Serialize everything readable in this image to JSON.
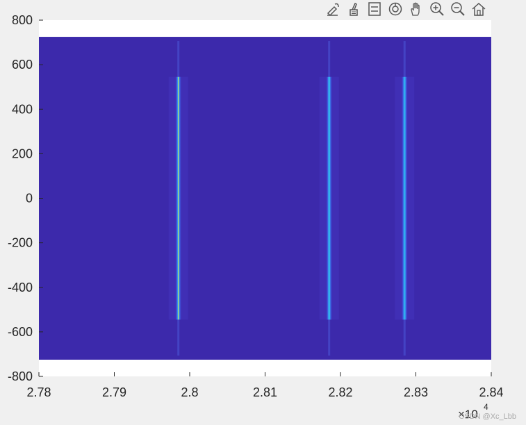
{
  "toolbar": {
    "icons": [
      "brush-edit-icon",
      "data-cursor-icon",
      "legend-icon",
      "rotate-icon",
      "pan-hand-icon",
      "zoom-in-icon",
      "zoom-out-icon",
      "home-icon"
    ]
  },
  "chart_data": {
    "type": "heatmap",
    "title": "",
    "xlabel": "",
    "ylabel": "",
    "xlim": [
      27800,
      28400
    ],
    "ylim": [
      -800,
      800
    ],
    "xticks": [
      2.78,
      2.79,
      2.8,
      2.81,
      2.82,
      2.83,
      2.84
    ],
    "xtick_labels": [
      "2.78",
      "2.79",
      "2.8",
      "2.81",
      "2.82",
      "2.83",
      "2.84"
    ],
    "x_exponent_label": "×10",
    "x_exponent_power": "4",
    "yticks": [
      800,
      600,
      400,
      200,
      0,
      -200,
      -400,
      -600,
      -800
    ],
    "ytick_labels": [
      "800",
      "600",
      "400",
      "200",
      "0",
      "-200",
      "-400",
      "-600",
      "-800"
    ],
    "image_extent": {
      "x": [
        27800,
        28400
      ],
      "y": [
        -725,
        725
      ]
    },
    "background_color": "#3c29ab",
    "ridges": [
      {
        "x": 27985,
        "y_range": [
          -545,
          545
        ],
        "peak_color": "#e9f542"
      },
      {
        "x": 28185,
        "y_range": [
          -545,
          545
        ],
        "peak_color": "#37d8e8"
      },
      {
        "x": 28285,
        "y_range": [
          -545,
          545
        ],
        "peak_color": "#2fb8ee"
      }
    ],
    "grid": false,
    "legend": "none"
  },
  "watermark": "CSDN @Xc_Lbb"
}
